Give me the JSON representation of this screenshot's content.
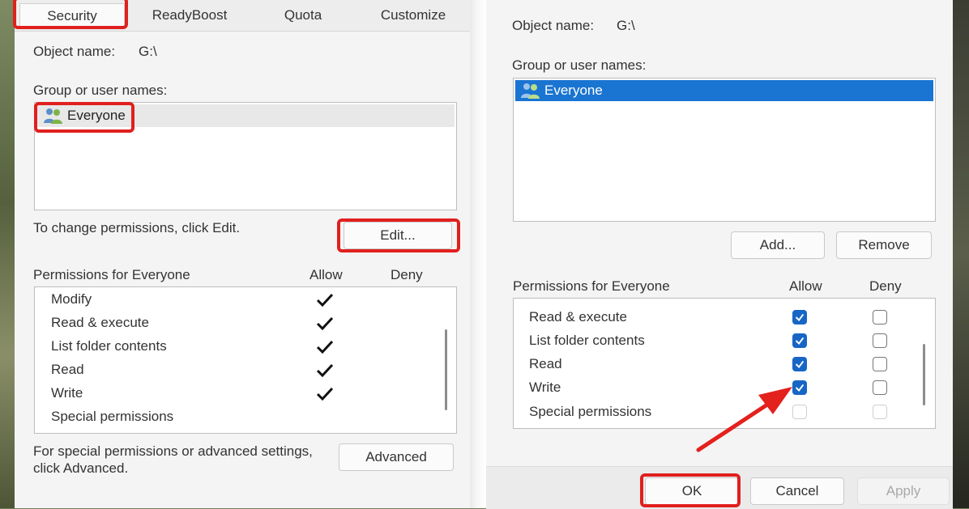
{
  "left_dialog": {
    "tabs": [
      "Security",
      "ReadyBoost",
      "Quota",
      "Customize"
    ],
    "object_name_label": "Object name:",
    "object_name_value": "G:\\",
    "group_label": "Group or user names:",
    "users": [
      "Everyone"
    ],
    "change_text": "To change permissions, click Edit.",
    "edit_button": "Edit...",
    "permissions_label": "Permissions for Everyone",
    "allow_header": "Allow",
    "deny_header": "Deny",
    "permissions": [
      {
        "name": "Modify",
        "allow": true
      },
      {
        "name": "Read & execute",
        "allow": true
      },
      {
        "name": "List folder contents",
        "allow": true
      },
      {
        "name": "Read",
        "allow": true
      },
      {
        "name": "Write",
        "allow": true
      },
      {
        "name": "Special permissions",
        "allow": false
      }
    ],
    "advanced_text_1": "For special permissions or advanced settings,",
    "advanced_text_2": "click Advanced.",
    "advanced_button": "Advanced"
  },
  "right_dialog": {
    "object_name_label": "Object name:",
    "object_name_value": "G:\\",
    "group_label": "Group or user names:",
    "users": [
      "Everyone"
    ],
    "add_button": "Add...",
    "remove_button": "Remove",
    "permissions_label": "Permissions for Everyone",
    "allow_header": "Allow",
    "deny_header": "Deny",
    "permissions": [
      {
        "name": "Read & execute",
        "allow": "checked",
        "deny": "unchecked"
      },
      {
        "name": "List folder contents",
        "allow": "checked",
        "deny": "unchecked"
      },
      {
        "name": "Read",
        "allow": "checked",
        "deny": "unchecked"
      },
      {
        "name": "Write",
        "allow": "checked",
        "deny": "unchecked"
      },
      {
        "name": "Special permissions",
        "allow": "disabled",
        "deny": "disabled"
      }
    ],
    "ok_button": "OK",
    "cancel_button": "Cancel",
    "apply_button": "Apply"
  },
  "colors": {
    "highlight": "#e0201e",
    "selection": "#1a74d1",
    "checkbox_checked": "#1766c6",
    "arrow": "#e3211d"
  },
  "icons": [
    "people-icon",
    "checkmark-icon",
    "red-arrow-annotation"
  ]
}
